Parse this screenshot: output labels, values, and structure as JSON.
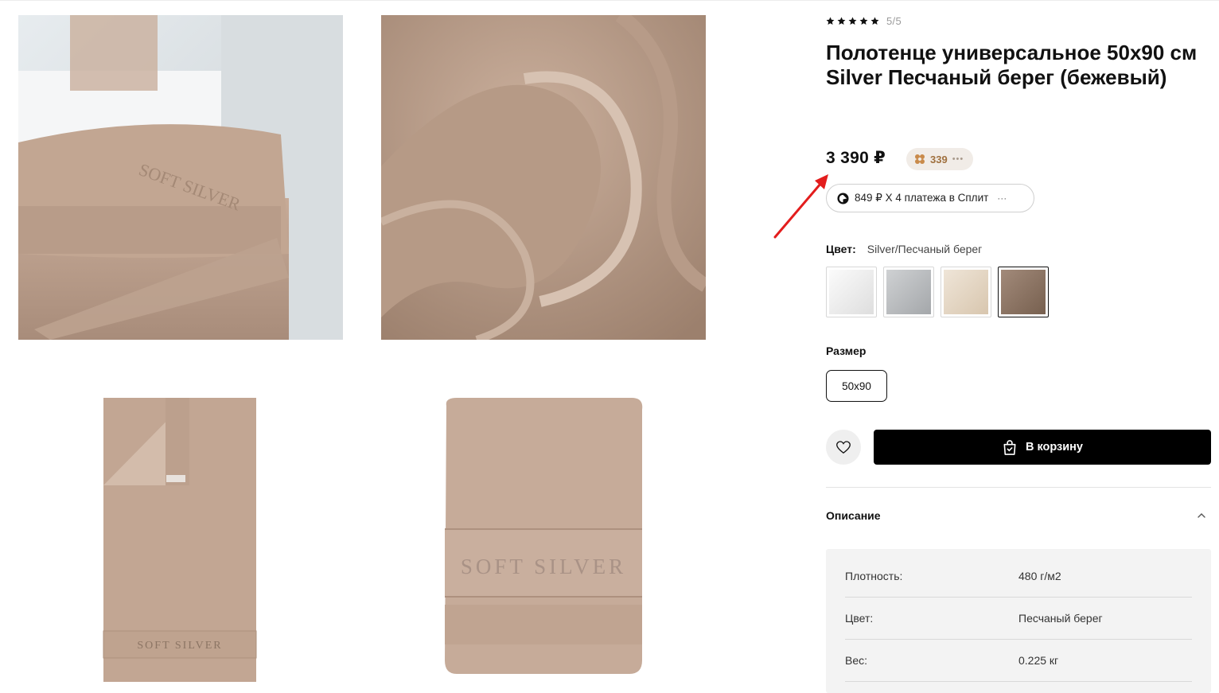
{
  "product": {
    "rating_value": 5,
    "rating_text": "5/5",
    "title": "Полотенце универсальное 50x90 см Silver Песчаный берег (бежевый)",
    "price": "3 390 ₽",
    "bonus": "339",
    "split_text": "849 ₽ X 4 платежа в Сплит",
    "color_label": "Цвет:",
    "color_value": "Silver/Песчаный берег",
    "swatches": [
      {
        "name": "white",
        "color": "#f2f2f2"
      },
      {
        "name": "grey",
        "color": "#b9bbbe"
      },
      {
        "name": "cream",
        "color": "#e6d8c6"
      },
      {
        "name": "sand",
        "color": "#8e7767",
        "selected": true
      }
    ],
    "size_label": "Размер",
    "size_option": "50x90",
    "cart_label": "В корзину",
    "description_label": "Описание",
    "specs": [
      {
        "key": "Плотность:",
        "value": "480 г/м2"
      },
      {
        "key": "Цвет:",
        "value": "Песчаный берег"
      },
      {
        "key": "Вес:",
        "value": "0.225 кг"
      }
    ]
  },
  "gallery": {
    "logo_text": "SOFT SILVER"
  },
  "colors": {
    "towel": "#c6aa98",
    "accent_bonus": "#a0713f",
    "arrow": "#e31d1d",
    "button": "#000000"
  }
}
